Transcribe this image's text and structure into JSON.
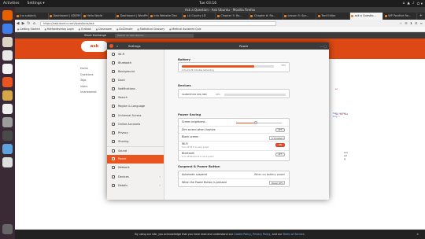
{
  "topbar": {
    "activities": "Activities",
    "app": "Settings ▾",
    "clock": "Tue 03:16",
    "tray": [
      "⌂",
      "▲",
      "♪",
      "⏻ ▾"
    ]
  },
  "window_title": "Ask a Question - Ask Ubuntu - Mozilla Firefox",
  "tabs": [
    {
      "label": "(no subject)"
    },
    {
      "label": "Dashboard | UDEMY"
    },
    {
      "label": "Hello World"
    },
    {
      "label": "Dashboard | WordPress"
    },
    {
      "label": "Info Website Dev"
    },
    {
      "label": "LA County LD"
    },
    {
      "label": "Chapter 5: Ro..."
    },
    {
      "label": "Chapter 6: Ro..."
    },
    {
      "label": "Lesson 5: Spr..."
    },
    {
      "label": "Text Editor"
    },
    {
      "label": "ask a Questio...",
      "active": true
    },
    {
      "label": "WP Positive Re..."
    }
  ],
  "tab_new": "+",
  "navbar": {
    "back": "◀",
    "forward": "▶",
    "reload": "↻",
    "home": "⌂",
    "url": "https://askubuntu.com/questions/ask",
    "tools": [
      "☆",
      "☰",
      "⬇",
      "⚙",
      "≡"
    ]
  },
  "bookmarks": [
    "Getting Started",
    "Hotfoxdevelop Login",
    "Outlook",
    "Classroom",
    "DxClimate",
    "Statistical Glossary",
    "Medical Assistant Quiz"
  ],
  "site": {
    "sebar_logo": "Stack Exchange",
    "search_placeholder": "Search on Ask Ubuntu...",
    "logo": "ask ubuntu",
    "leftnav": [
      "Home",
      "Questions",
      "Tags",
      "Users",
      "Unanswered"
    ],
    "right_red": [
      "ar",
      "ne, we use"
    ],
    "right_help": [
      "help center ›",
      "ting >"
    ],
    "right_note": [
      "eur",
      "all",
      "g"
    ]
  },
  "settings": {
    "title": "Settings",
    "panel_title": "Power",
    "search_icon": "search-icon",
    "sidebar": [
      {
        "label": "Wi-Fi",
        "icon": "wifi-icon"
      },
      {
        "label": "Bluetooth",
        "icon": "bluetooth-icon"
      },
      {
        "label": "Background",
        "icon": "background-icon"
      },
      {
        "label": "Dock",
        "icon": "dock-icon"
      },
      {
        "label": "Notifications",
        "icon": "bell-icon"
      },
      {
        "label": "Search",
        "icon": "search-icon"
      },
      {
        "label": "Region & Language",
        "icon": "globe-icon"
      },
      {
        "label": "Universal Access",
        "icon": "accessibility-icon"
      },
      {
        "label": "Online Accounts",
        "icon": "cloud-icon"
      },
      {
        "label": "Privacy",
        "icon": "hand-icon"
      },
      {
        "label": "Sharing",
        "icon": "share-icon"
      },
      {
        "label": "Sound",
        "icon": "speaker-icon"
      },
      {
        "label": "Power",
        "icon": "power-icon",
        "selected": true
      },
      {
        "label": "Network",
        "icon": "network-icon"
      },
      {
        "label": "Devices",
        "icon": "devices-icon",
        "chevron": "›"
      },
      {
        "label": "Details",
        "icon": "details-icon",
        "chevron": "›"
      }
    ],
    "battery": {
      "heading": "Battery",
      "remaining": "4 hours 22 minutes remaining",
      "percent_label": "79%",
      "level": 0.79
    },
    "devices": {
      "heading": "Devices",
      "device": "SLANDSTOCK 949 206C",
      "percent_label": "90%",
      "level": 0.0
    },
    "power_saving": {
      "heading": "Power Saving",
      "brightness_label": "Screen brightness",
      "brightness_level": 0.43,
      "dim_label": "Dim screen when inactive",
      "dim_toggle": "OFF",
      "blank_label": "Blank screen",
      "blank_value": "5 minutes ▾",
      "wifi_label": "Wi-Fi",
      "wifi_sub": "Turn off Wi-Fi to save power",
      "wifi_toggle": "ON",
      "bt_label": "Bluetooth",
      "bt_sub": "Turn off Bluetooth to save power",
      "bt_toggle": "OFF"
    },
    "suspend": {
      "heading": "Suspend & Power Button",
      "auto_label": "Automatic suspend",
      "auto_value": "When on battery power",
      "button_label": "When the Power Button is pressed",
      "button_value": "Power Off ▾"
    }
  },
  "statusbar": {
    "text_pre": "By using our site, you acknowledge that you have read and understand our ",
    "cookie": "Cookie Policy",
    "sep1": ", ",
    "privacy": "Privacy Policy",
    "sep2": ", and our ",
    "terms": "Terms of Service",
    "text_post": ".",
    "close": "✕"
  },
  "colors": {
    "accent": "#e95420",
    "site_orange": "#dd4814",
    "dock": "#3a2a36"
  }
}
